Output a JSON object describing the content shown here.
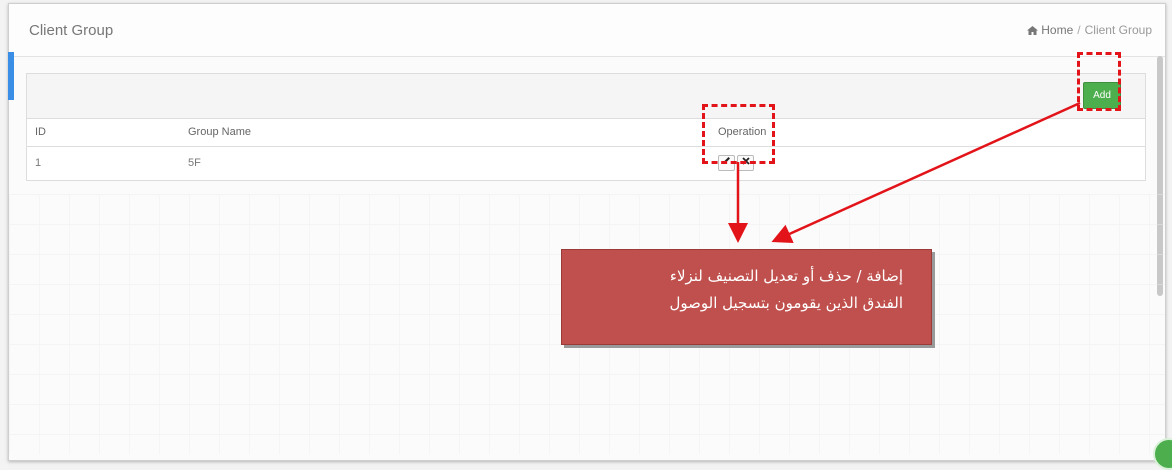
{
  "header": {
    "title": "Client Group",
    "breadcrumb": {
      "home": "Home",
      "separator": "/",
      "current": "Client Group"
    }
  },
  "toolbar": {
    "add_label": "Add"
  },
  "table": {
    "columns": [
      "ID",
      "Group Name",
      "Operation"
    ],
    "rows": [
      {
        "id": "1",
        "group_name": "5F",
        "edit_icon": "pencil-icon",
        "delete_icon": "close-icon"
      }
    ]
  },
  "annotation": {
    "line1": "إضافة / حذف أو تعديل التصنيف لنزلاء",
    "line2": "الفندق الذين يقومون بتسجيل الوصول"
  },
  "colors": {
    "accent_blue": "#3a8ee6",
    "add_green": "#4cae4c",
    "callout_red": "#c0504d",
    "marker_red": "#e2141a"
  }
}
